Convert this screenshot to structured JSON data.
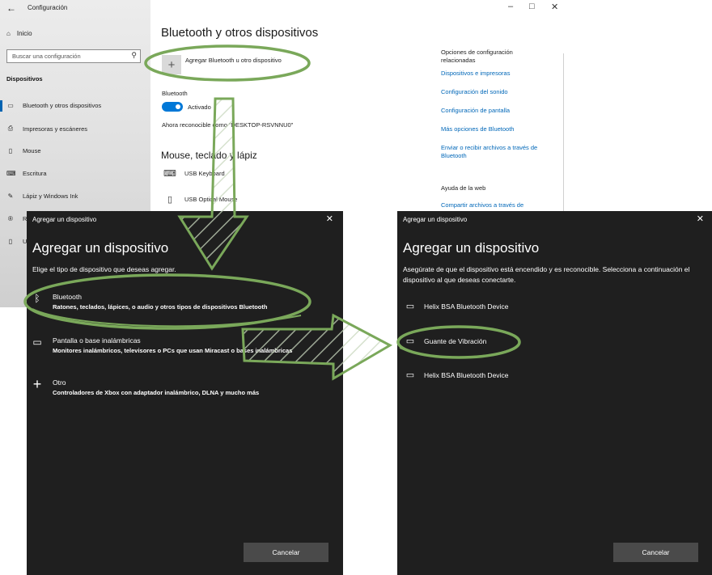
{
  "settings": {
    "window_title": "Configuración",
    "controls": {
      "minimize": "–",
      "maximize": "□",
      "close": "✕"
    },
    "sidebar": {
      "home": "Inicio",
      "search_placeholder": "Buscar una configuración",
      "section": "Dispositivos",
      "items": [
        {
          "label": "Bluetooth y otros dispositivos",
          "icon": "bluetooth-device-icon"
        },
        {
          "label": "Impresoras y escáneres",
          "icon": "printer-icon"
        },
        {
          "label": "Mouse",
          "icon": "mouse-icon"
        },
        {
          "label": "Escritura",
          "icon": "keyboard-icon"
        },
        {
          "label": "Lápiz y Windows Ink",
          "icon": "pen-icon"
        },
        {
          "label": "R",
          "icon": "autoplay-icon"
        },
        {
          "label": "U",
          "icon": "usb-icon"
        }
      ]
    },
    "main": {
      "title": "Bluetooth y otros dispositivos",
      "add_device": "Agregar Bluetooth u otro dispositivo",
      "bluetooth_label": "Bluetooth",
      "toggle_state": "Activado",
      "discoverable": "Ahora reconocible como \"DESKTOP-RSVNNU0\"",
      "section_mouse": "Mouse, teclado y lápiz",
      "devices": [
        {
          "name": "USB Keyboard",
          "icon": "keyboard-icon"
        },
        {
          "name": "USB Optical Mouse",
          "icon": "mouse-icon"
        }
      ]
    },
    "related": {
      "heading": "Opciones de configuración relacionadas",
      "links": [
        "Dispositivos e impresoras",
        "Configuración del sonido",
        "Configuración de pantalla",
        "Más opciones de Bluetooth",
        "Enviar o recibir archivos a través de Bluetooth"
      ],
      "help_heading": "Ayuda de la web",
      "help_link": "Compartir archivos a través de"
    }
  },
  "dialog_left": {
    "title": "Agregar un dispositivo",
    "close": "✕",
    "heading": "Agregar un dispositivo",
    "instruction": "Elige el tipo de dispositivo que deseas agregar.",
    "options": [
      {
        "name": "Bluetooth",
        "desc": "Ratones, teclados, lápices, o audio y otros tipos de dispositivos Bluetooth",
        "icon": "bluetooth-icon"
      },
      {
        "name": "Pantalla o base inalámbricas",
        "desc": "Monitores inalámbricos, televisores o PCs que usan Miracast o bases inalámbricas",
        "icon": "monitor-icon"
      },
      {
        "name": "Otro",
        "desc": "Controladores de Xbox con adaptador inalámbrico, DLNA y mucho más",
        "icon": "plus-icon"
      }
    ],
    "cancel": "Cancelar"
  },
  "dialog_right": {
    "title": "Agregar un dispositivo",
    "close": "✕",
    "heading": "Agregar un dispositivo",
    "instruction": "Asegúrate de que el dispositivo está encendido y es reconocible. Selecciona a continuación el dispositivo al que deseas conectarte.",
    "devices": [
      {
        "name": "Helix BSA Bluetooth Device",
        "icon": "monitor-icon"
      },
      {
        "name": "Guante de Vibración",
        "icon": "computer-icon"
      },
      {
        "name": "Helix BSA Bluetooth Device",
        "icon": "monitor-icon"
      }
    ],
    "cancel": "Cancelar"
  },
  "annotation_color": "#7aa85a"
}
